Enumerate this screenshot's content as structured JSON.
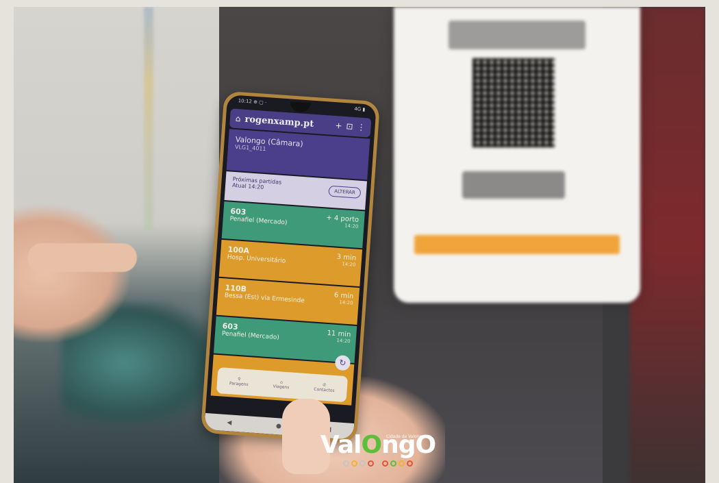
{
  "phone": {
    "status_left": "10:12 ⊕ ▢ ·",
    "status_right": "4G ▮",
    "url": "rogenxamp.pt",
    "stop_name": "Valongo (Câmara)",
    "stop_code": "VLG1_4011",
    "next_label": "Próximas partidas",
    "next_time": "Atual 14:20",
    "next_button": "ALTERAR",
    "departures": [
      {
        "line": "603",
        "dest": "Penafiel (Mercado)",
        "time": "+ 4 porto",
        "sub": "14:20"
      },
      {
        "line": "100A",
        "dest": "Hosp. Universitário",
        "time": "3 min",
        "sub": "14:20"
      },
      {
        "line": "110B",
        "dest": "Bessa (Est) via Ermesinde",
        "time": "6 min",
        "sub": "14:20"
      },
      {
        "line": "603",
        "dest": "Penafiel (Mercado)",
        "time": "11 min",
        "sub": "14:20"
      }
    ],
    "nav": [
      "Paragens",
      "Viagens",
      "Contactos"
    ]
  },
  "logo": {
    "text_before": "Val",
    "text_mark": "O",
    "text_after": "ngO",
    "tagline": "Cidade de Valongo"
  },
  "colors": {
    "accent": "#4b3f8c",
    "green_row": "#3e9a79",
    "orange_row": "#dd9b2c"
  }
}
